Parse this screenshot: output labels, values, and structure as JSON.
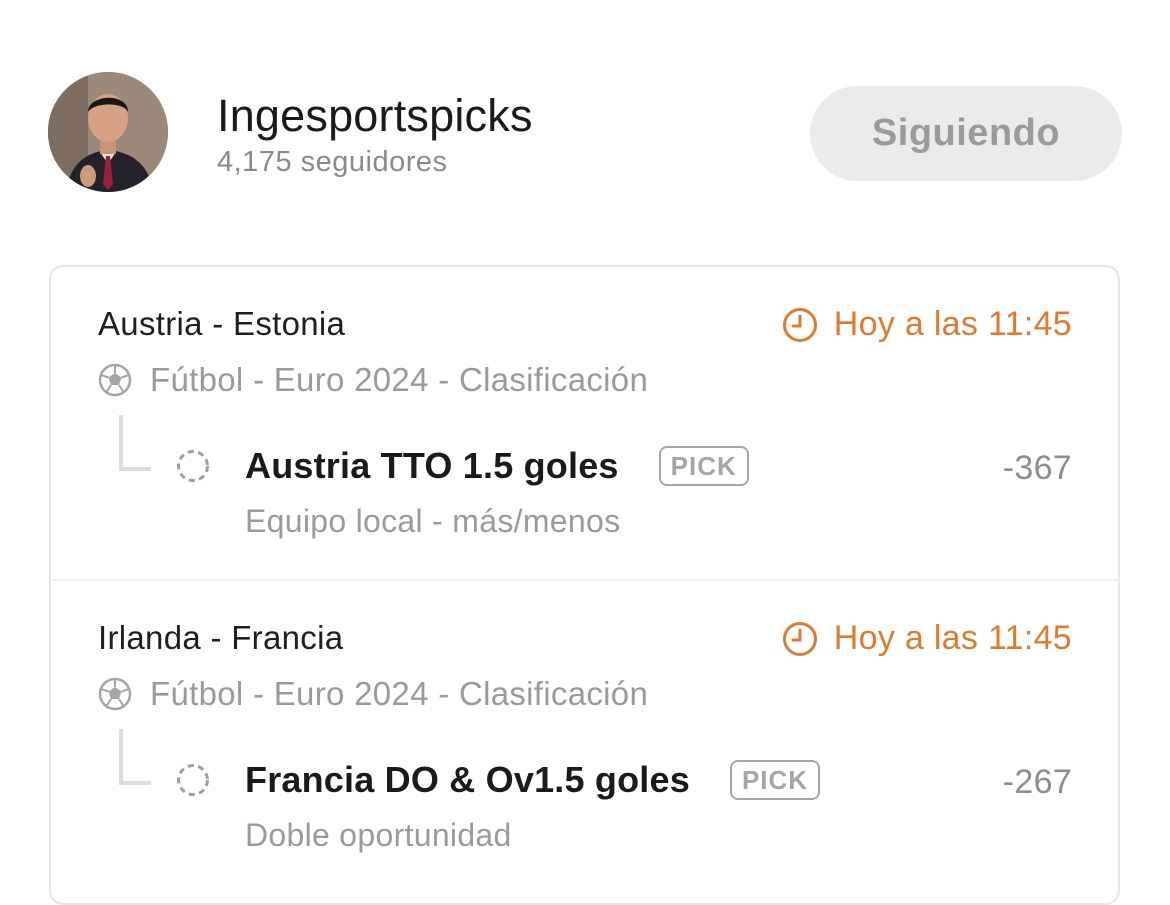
{
  "profile": {
    "name": "Ingesportspicks",
    "followers": "4,175 seguidores",
    "follow_button": "Siguiendo"
  },
  "icons": {
    "clock": "clock-icon",
    "league": "soccer-ball-icon",
    "status": "pending-circle-icon"
  },
  "colors": {
    "accent": "#e07a2e",
    "muted_text": "#9a9a9a",
    "button_bg": "#ebebeb"
  },
  "matches": [
    {
      "teams": "Austria - Estonia",
      "time": "Hoy a las 11:45",
      "league": "Fútbol - Euro 2024 - Clasificación",
      "pick": "Austria TTO 1.5 goles",
      "badge": "PICK",
      "odds": "-367",
      "market": "Equipo local - más/menos"
    },
    {
      "teams": "Irlanda - Francia",
      "time": "Hoy a las 11:45",
      "league": "Fútbol - Euro 2024 - Clasificación",
      "pick": "Francia DO & Ov1.5 goles",
      "badge": "PICK",
      "odds": "-267",
      "market": "Doble oportunidad"
    }
  ]
}
